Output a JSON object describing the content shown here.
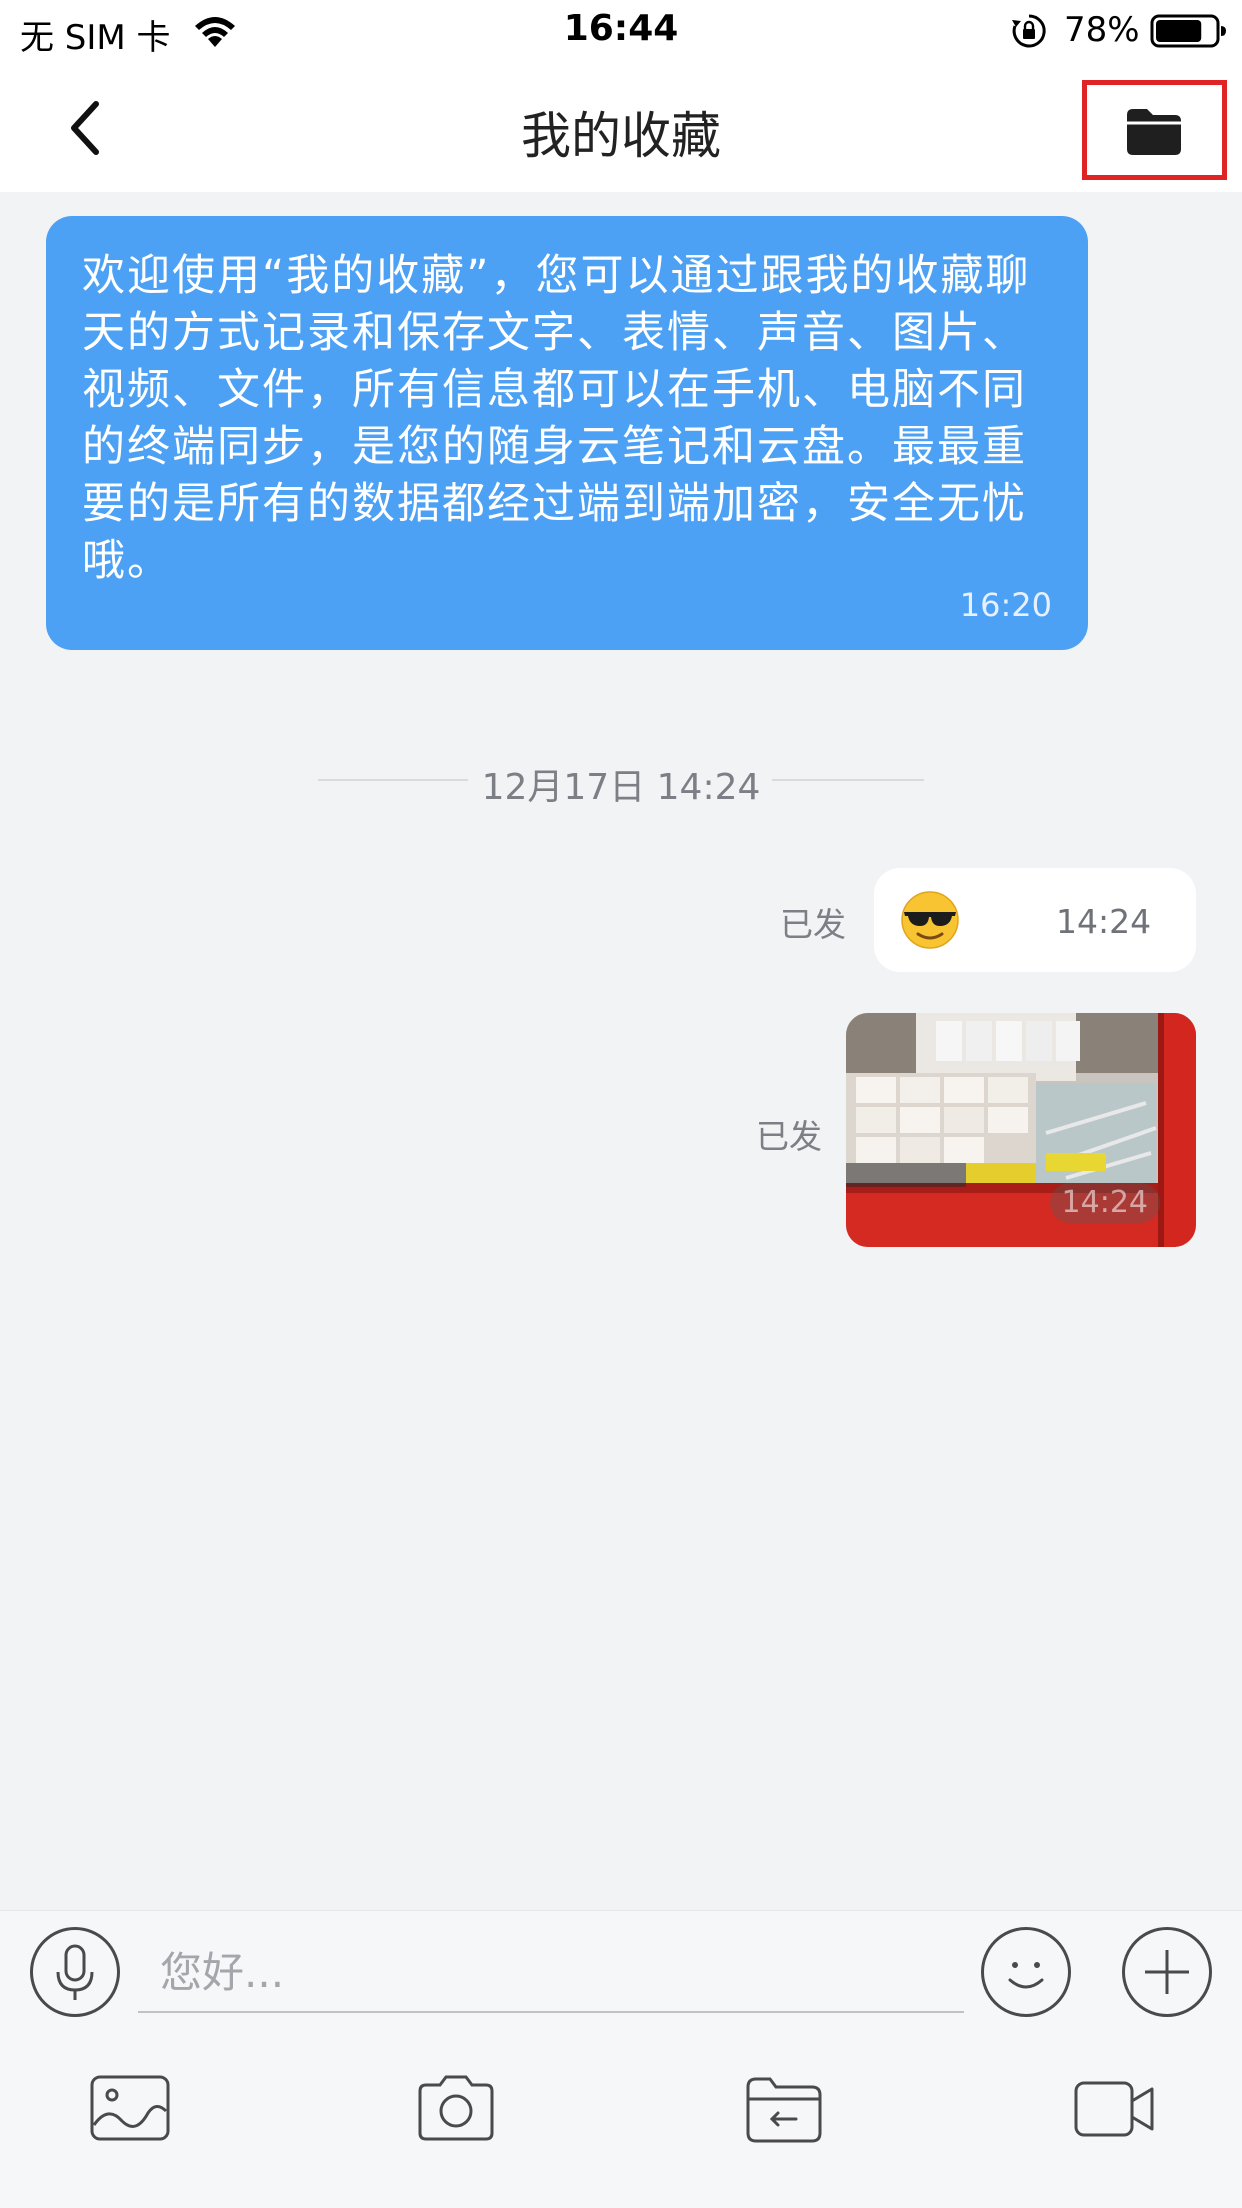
{
  "status_bar": {
    "carrier": "无 SIM 卡",
    "time": "16:44",
    "battery_percent": "78%",
    "battery_level": 0.78,
    "icons": [
      "wifi-icon",
      "orientation-lock-icon",
      "battery-icon"
    ]
  },
  "nav": {
    "title": "我的收藏",
    "back_icon": "chevron-left-icon",
    "folder_icon": "folder-icon",
    "highlight_color": "#e02424"
  },
  "messages": {
    "welcome": {
      "text": "欢迎使用“我的收藏”，您可以通过跟我的收藏聊天的方式记录和保存文字、表情、声音、图片、视频、文件，所有信息都可以在手机、电脑不同的终端同步，是您的随身云笔记和云盘。最最重要的是所有的数据都经过端到端加密，安全无忧哦。",
      "time": "16:20",
      "bubble_color": "#4da1f5"
    },
    "date_separator": "12月17日 14:24",
    "emoji_msg": {
      "status": "已发",
      "emoji": "smiling-face-with-sunglasses",
      "time": "14:24"
    },
    "image_msg": {
      "status": "已发",
      "time": "14:24"
    }
  },
  "input": {
    "placeholder": "您好...",
    "value": "",
    "buttons": [
      "microphone-icon",
      "smiley-icon",
      "plus-icon"
    ]
  },
  "toolbar": {
    "items": [
      "image-icon",
      "camera-icon",
      "folder-upload-icon",
      "video-camera-icon"
    ]
  }
}
